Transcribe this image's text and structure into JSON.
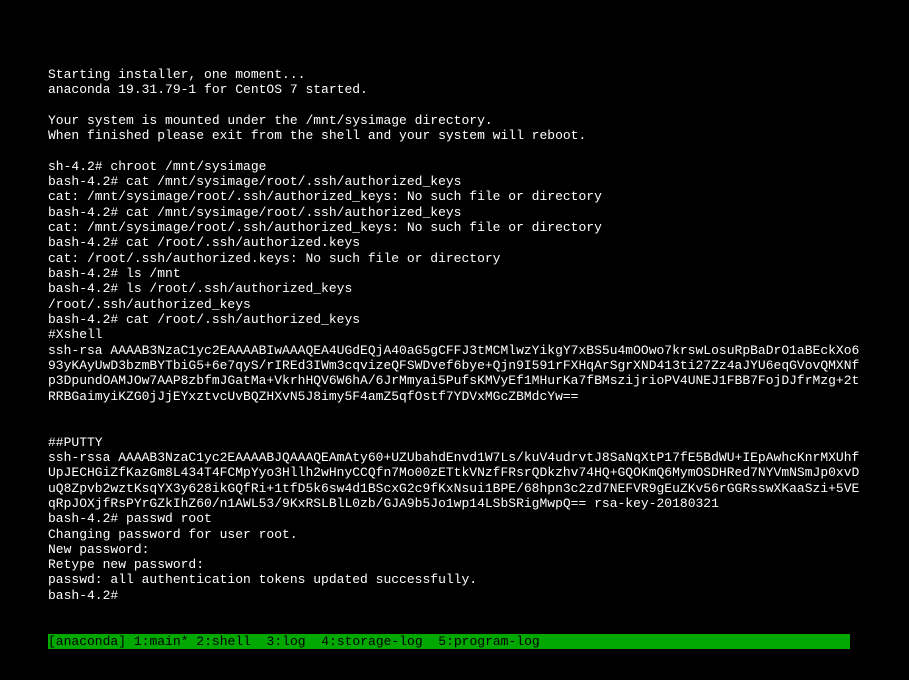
{
  "lines": [
    "Starting installer, one moment...",
    "anaconda 19.31.79-1 for CentOS 7 started.",
    "",
    "Your system is mounted under the /mnt/sysimage directory.",
    "When finished please exit from the shell and your system will reboot.",
    "",
    "sh-4.2# chroot /mnt/sysimage",
    "bash-4.2# cat /mnt/sysimage/root/.ssh/authorized_keys",
    "cat: /mnt/sysimage/root/.ssh/authorized_keys: No such file or directory",
    "bash-4.2# cat /mnt/sysimage/root/.ssh/authorized_keys",
    "cat: /mnt/sysimage/root/.ssh/authorized_keys: No such file or directory",
    "bash-4.2# cat /root/.ssh/authorized.keys",
    "cat: /root/.ssh/authorized.keys: No such file or directory",
    "bash-4.2# ls /mnt",
    "bash-4.2# ls /root/.ssh/authorized_keys",
    "/root/.ssh/authorized_keys",
    "bash-4.2# cat /root/.ssh/authorized_keys",
    "#Xshell",
    "ssh-rsa AAAAB3NzaC1yc2EAAAABIwAAAQEA4UGdEQjA40aG5gCFFJ3tMCMlwzYikgY7xBS5u4mOOwo7krswLosuRpBaDrO1aBEckXo693yKAyUwD3bzmBYTbiG5+6e7qyS/rIREd3IWm3cqvizeQFSWDvef6bye+Qjn9I591rFXHqArSgrXND413ti27Zz4aJYU6eqGVovQMXNfp3DpundOAMJOw7AAP8zbfmJGatMa+VkrhHQV6W6hA/6JrMmyai5PufsKMVyEf1MHurKa7fBMszijrioPV4UNEJ1FBB7FojDJfrMzg+2tRRBGaimyiKZG0jJjEYxztvcUvBQZHXvN5J8imy5F4amZ5qfOstf7YDVxMGcZBMdcYw==",
    "",
    "",
    "##PUTTY",
    "ssh-rssa AAAAB3NzaC1yc2EAAAABJQAAAQEAmAty60+UZUbahdEnvd1W7Ls/kuV4udrvtJ8SaNqXtP17fE5BdWU+IEpAwhcKnrMXUhfUpJECHGiZfKazGm8L434T4FCMpYyo3Hllh2wHnyCCQfn7Mo00zETtkVNzfFRsrQDkzhv74HQ+GQOKmQ6MymOSDHRed7NYVmNSmJp0xvDuQ8Zpvb2wztKsqYX3y628ikGQfRi+1tfD5k6sw4d1BScxG2c9fKxNsui1BPE/68hpn3c2zd7NEFVR9gEuZKv56rGGRsswXKaaSzi+5VEqRpJOXjfRsPYrGZkIhZ60/n1AWL53/9KxRSLBlL0zb/GJA9b5Jo1wp14LSbSRigMwpQ== rsa-key-20180321",
    "bash-4.2# passwd root",
    "Changing password for user root.",
    "New password:",
    "Retype new password:",
    "passwd: all authentication tokens updated successfully.",
    "bash-4.2#"
  ],
  "status_bar": {
    "session": "[anaconda]",
    "tabs": [
      {
        "num": "1",
        "name": "main",
        "marker": "*"
      },
      {
        "num": "2",
        "name": "shell",
        "marker": ""
      },
      {
        "num": "3",
        "name": "log",
        "marker": ""
      },
      {
        "num": "4",
        "name": "storage-log",
        "marker": ""
      },
      {
        "num": "5",
        "name": "program-log",
        "marker": ""
      }
    ]
  }
}
